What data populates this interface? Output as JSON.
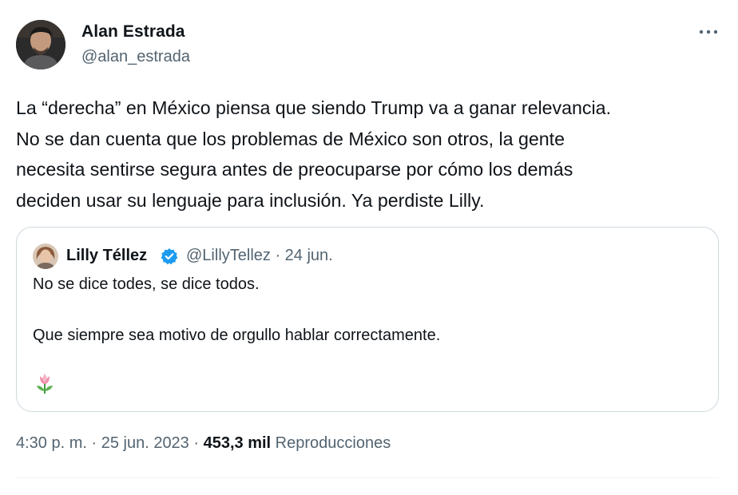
{
  "tweet": {
    "author": {
      "name": "Alan Estrada",
      "handle": "@alan_estrada"
    },
    "text": "La “derecha” en México piensa que siendo Trump va a ganar relevancia.\nNo se dan cuenta que los problemas de México son otros, la gente\nnecesita  sentirse segura antes de preocuparse por cómo los demás\ndeciden usar su lenguaje para inclusión. Ya perdiste Lilly.",
    "more_icon": "more-horizontal-icon",
    "quote": {
      "name": "Lilly Téllez",
      "verified_icon": "verified-badge-icon",
      "handle_date": "@LillyTellez · 24 jun.",
      "line1": "No se dice todes, se dice todos.",
      "line2": "Que siempre sea motivo de orgullo hablar correctamente.",
      "emoji_icon": "tulip-icon"
    },
    "footer": {
      "time_date": "4:30 p. m. · 25 jun. 2023 · ",
      "views_count": "453,3 mil",
      "views_label": " Reproducciones"
    }
  },
  "colors": {
    "text": "#0f1419",
    "secondary": "#536471",
    "border": "#cfd9de",
    "verified": "#1d9bf0"
  }
}
